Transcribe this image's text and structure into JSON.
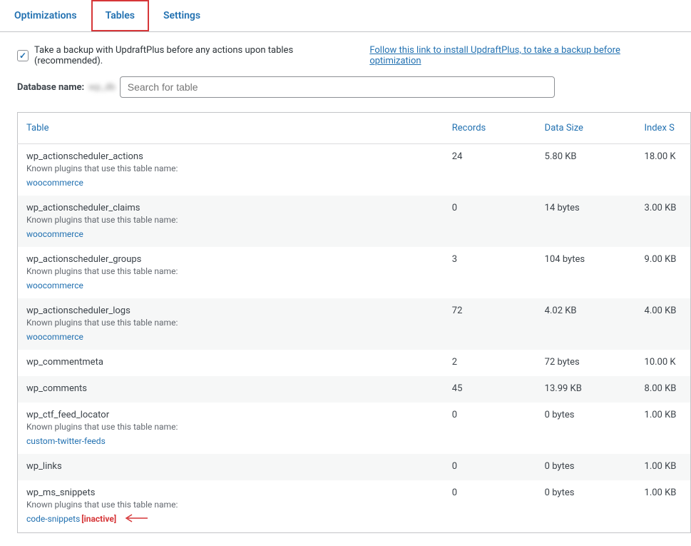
{
  "tabs": {
    "optimizations": "Optimizations",
    "tables": "Tables",
    "settings": "Settings"
  },
  "backup": {
    "label": "Take a backup with UpdraftPlus before any actions upon tables (recommended).",
    "link": "Follow this link to install UpdraftPlus, to take a backup before optimization"
  },
  "dbname": {
    "label": "Database name:",
    "value": "wp_db"
  },
  "search": {
    "placeholder": "Search for table"
  },
  "columns": {
    "table": "Table",
    "records": "Records",
    "datasize": "Data Size",
    "indexsize": "Index S"
  },
  "known_label": "Known plugins that use this table name:",
  "inactive_label": "[inactive]",
  "rows": [
    {
      "name": "wp_actionscheduler_actions",
      "records": "24",
      "datasize": "5.80 KB",
      "indexsize": "18.00 K",
      "plugins": [
        "woocommerce"
      ],
      "inactive": false
    },
    {
      "name": "wp_actionscheduler_claims",
      "records": "0",
      "datasize": "14 bytes",
      "indexsize": "3.00 KB",
      "plugins": [
        "woocommerce"
      ],
      "inactive": false
    },
    {
      "name": "wp_actionscheduler_groups",
      "records": "3",
      "datasize": "104 bytes",
      "indexsize": "9.00 KB",
      "plugins": [
        "woocommerce"
      ],
      "inactive": false
    },
    {
      "name": "wp_actionscheduler_logs",
      "records": "72",
      "datasize": "4.02 KB",
      "indexsize": "4.00 KB",
      "plugins": [
        "woocommerce"
      ],
      "inactive": false
    },
    {
      "name": "wp_commentmeta",
      "records": "2",
      "datasize": "72 bytes",
      "indexsize": "10.00 K",
      "plugins": [],
      "inactive": false
    },
    {
      "name": "wp_comments",
      "records": "45",
      "datasize": "13.99 KB",
      "indexsize": "8.00 KB",
      "plugins": [],
      "inactive": false
    },
    {
      "name": "wp_ctf_feed_locator",
      "records": "0",
      "datasize": "0 bytes",
      "indexsize": "1.00 KB",
      "plugins": [
        "custom-twitter-feeds"
      ],
      "inactive": false
    },
    {
      "name": "wp_links",
      "records": "0",
      "datasize": "0 bytes",
      "indexsize": "1.00 KB",
      "plugins": [],
      "inactive": false
    },
    {
      "name": "wp_ms_snippets",
      "records": "0",
      "datasize": "0 bytes",
      "indexsize": "1.00 KB",
      "plugins": [
        "code-snippets"
      ],
      "inactive": true
    }
  ]
}
